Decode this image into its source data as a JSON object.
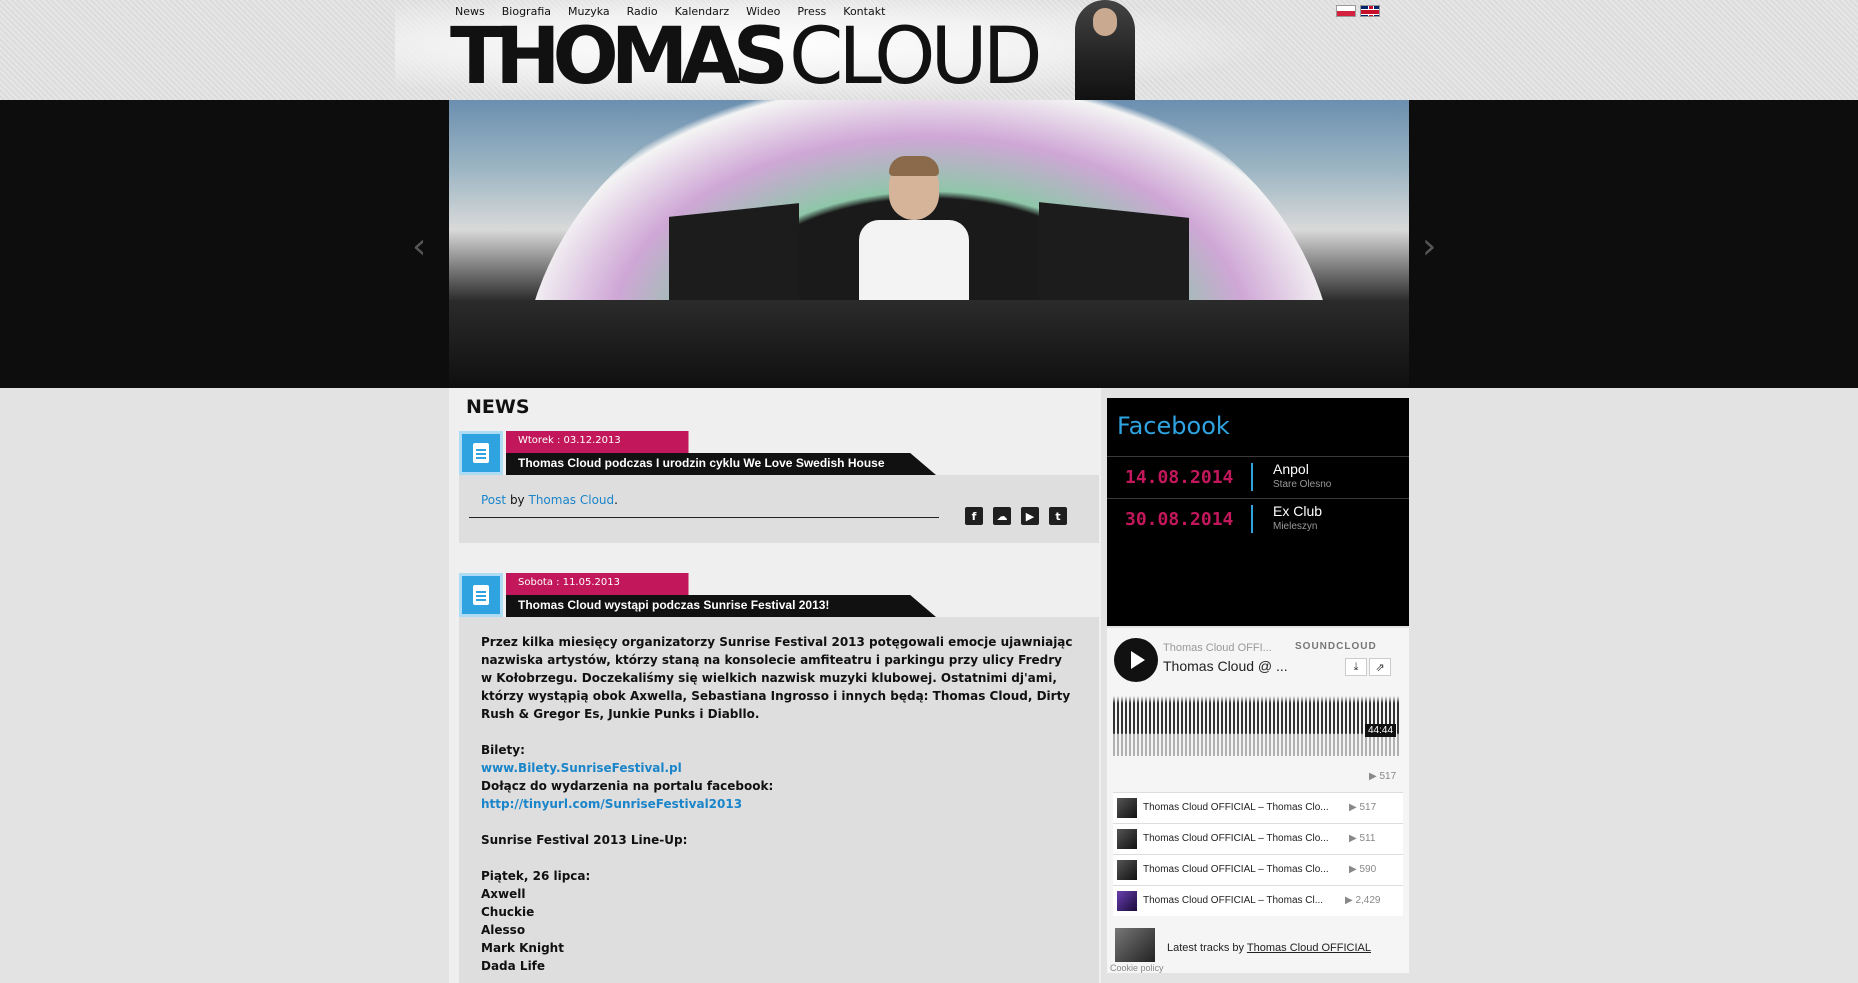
{
  "nav": {
    "items": [
      "News",
      "Biografia",
      "Muzyka",
      "Radio",
      "Kalendarz",
      "Wideo",
      "Press",
      "Kontakt"
    ]
  },
  "logo": {
    "bold": "THOMAS",
    "thin": "CLOUD"
  },
  "hero": {
    "prev": "‹",
    "next": "›"
  },
  "news": {
    "section_title": "NEWS",
    "posts": [
      {
        "date": "Wtorek : 03.12.2013",
        "title": "Thomas Cloud podczas I urodzin cyklu We Love Swedish House",
        "byline_link": "Post",
        "byline_by": "by",
        "byline_author": "Thomas Cloud",
        "byline_end": "."
      },
      {
        "date": "Sobota : 11.05.2013",
        "title": "Thomas Cloud wystąpi podczas Sunrise Festival 2013!",
        "intro": "Przez kilka miesięcy organizatorzy Sunrise Festival 2013 potęgowali emocje ujawniając nazwiska artystów, którzy staną na konsolecie amfiteatru i parkingu przy ulicy Fredry w Kołobrzegu. Doczekaliśmy się wielkich nazwisk muzyki klubowej. Ostatnimi dj'ami, którzy wystąpią obok Axwella, Sebastiana Ingrosso i innych będą: Thomas Cloud, Dirty Rush & Gregor Es, Junkie Punks i Diabllo.",
        "tickets_label": "Bilety:",
        "tickets_link": "www.Bilety.SunriseFestival.pl",
        "fb_label": "Dołącz do wydarzenia na portalu facebook:",
        "fb_link": "http://tinyurl.com/SunriseFestival2013",
        "lineup_title": "Sunrise Festival 2013 Line-Up:",
        "day_label": "Piątek, 26 lipca:",
        "lineup": [
          "Axwell",
          "Chuckie",
          "Alesso",
          "Mark Knight",
          "Dada Life"
        ]
      }
    ]
  },
  "sidebar": {
    "facebook_title": "Facebook",
    "events": [
      {
        "date": "14.08.2014",
        "venue": "Anpol",
        "city": "Stare Olesno"
      },
      {
        "date": "30.08.2014",
        "venue": "Ex Club",
        "city": "Mieleszyn"
      }
    ]
  },
  "soundcloud": {
    "user": "Thomas Cloud OFFI...",
    "brand": "SOUNDCLOUD",
    "track": "Thomas Cloud @ ...",
    "duration": "44:44",
    "plays": "517",
    "tracks": [
      {
        "title": "Thomas Cloud OFFICIAL – Thomas Clo...",
        "plays": "517"
      },
      {
        "title": "Thomas Cloud OFFICIAL – Thomas Clo...",
        "plays": "511"
      },
      {
        "title": "Thomas Cloud OFFICIAL – Thomas Clo...",
        "plays": "590"
      },
      {
        "title": "Thomas Cloud OFFICIAL – Thomas Cl...",
        "plays": "2,429"
      }
    ],
    "footer_prefix": "Latest tracks by",
    "footer_link": "Thomas Cloud OFFICIAL"
  },
  "cookie": "Cookie policy",
  "colors": {
    "accent_blue": "#2ea3e0",
    "accent_pink": "#c2185b"
  }
}
